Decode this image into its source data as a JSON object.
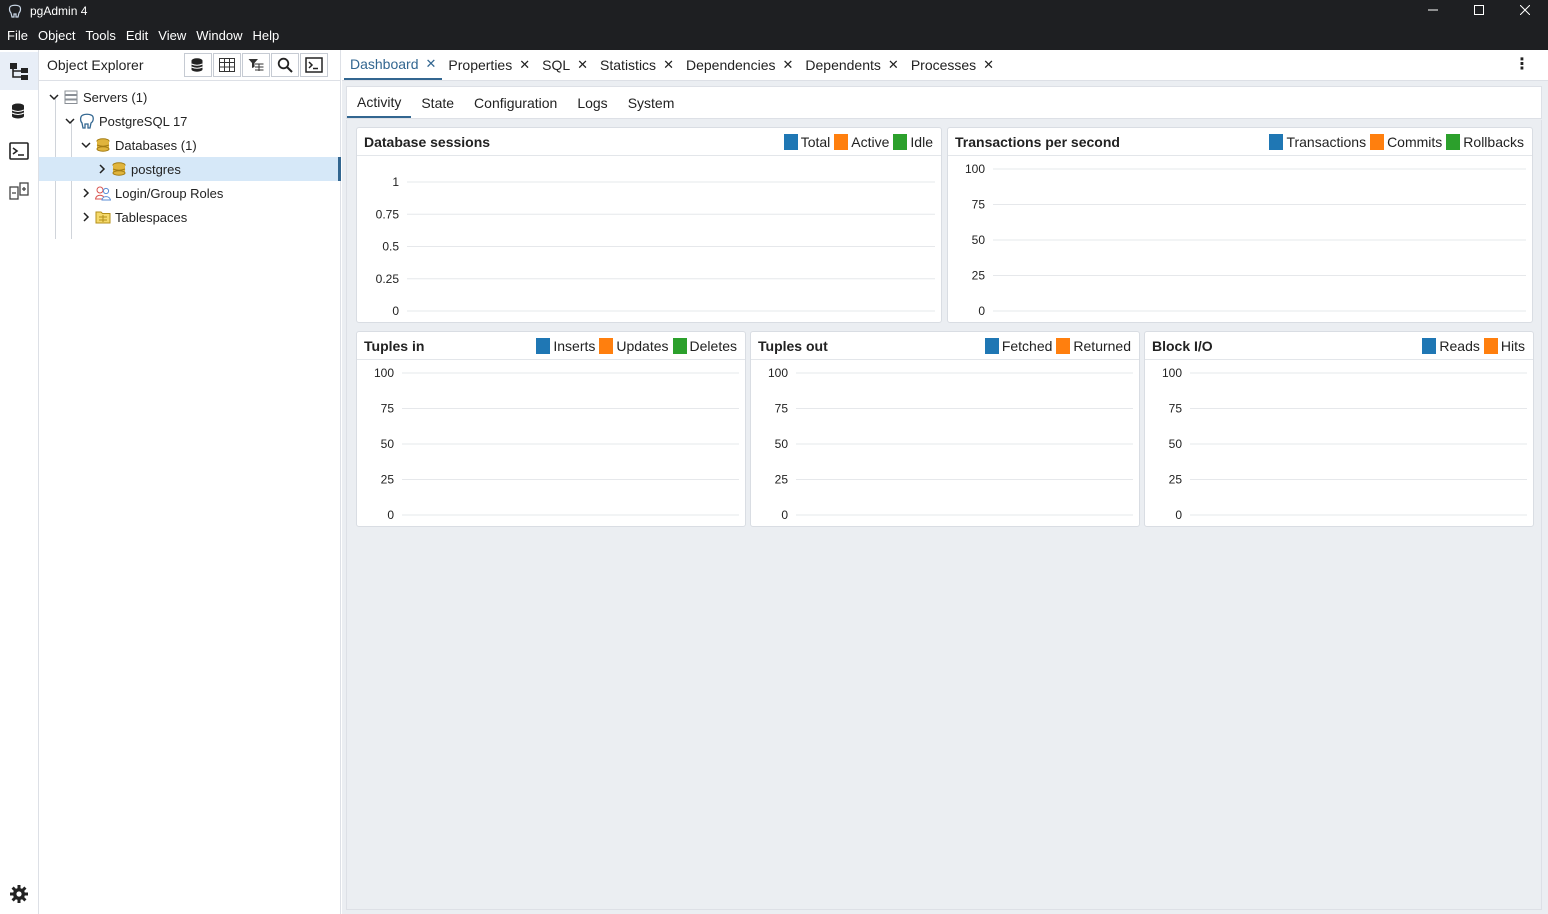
{
  "window": {
    "title": "pgAdmin 4"
  },
  "menu": [
    "File",
    "Object",
    "Tools",
    "Edit",
    "View",
    "Window",
    "Help"
  ],
  "explorer": {
    "title": "Object Explorer",
    "tree": [
      {
        "label": "Servers",
        "count": "(1)",
        "icon": "servers-icon",
        "level": 0,
        "expanded": true
      },
      {
        "label": "PostgreSQL 17",
        "count": "",
        "icon": "postgresql-elephant-icon",
        "level": 1,
        "expanded": true
      },
      {
        "label": "Databases",
        "count": "(1)",
        "icon": "databases-icon",
        "level": 2,
        "expanded": true
      },
      {
        "label": "postgres",
        "count": "",
        "icon": "database-icon",
        "level": 3,
        "expanded": false,
        "selected": true
      },
      {
        "label": "Login/Group Roles",
        "count": "",
        "icon": "roles-icon",
        "level": 2,
        "expanded": false
      },
      {
        "label": "Tablespaces",
        "count": "",
        "icon": "tablespaces-icon",
        "level": 2,
        "expanded": false
      }
    ]
  },
  "tabs": [
    {
      "label": "Dashboard",
      "active": true
    },
    {
      "label": "Properties"
    },
    {
      "label": "SQL"
    },
    {
      "label": "Statistics"
    },
    {
      "label": "Dependencies"
    },
    {
      "label": "Dependents"
    },
    {
      "label": "Processes"
    }
  ],
  "subtabs": [
    {
      "label": "Activity",
      "active": true
    },
    {
      "label": "State"
    },
    {
      "label": "Configuration"
    },
    {
      "label": "Logs"
    },
    {
      "label": "System"
    }
  ],
  "colors": {
    "blue": "#1f77b4",
    "orange": "#ff7f0e",
    "green": "#2ca02c",
    "accent": "#326690"
  },
  "chart_data": [
    {
      "type": "line",
      "title": "Database sessions",
      "series": [
        {
          "name": "Total",
          "color": "#1f77b4",
          "values": []
        },
        {
          "name": "Active",
          "color": "#ff7f0e",
          "values": []
        },
        {
          "name": "Idle",
          "color": "#2ca02c",
          "values": []
        }
      ],
      "yticks": [
        "0",
        "0.25",
        "0.5",
        "0.75",
        "1"
      ],
      "ylim": [
        0,
        1
      ],
      "grid": true,
      "legend": "top-right"
    },
    {
      "type": "line",
      "title": "Transactions per second",
      "series": [
        {
          "name": "Transactions",
          "color": "#1f77b4",
          "values": []
        },
        {
          "name": "Commits",
          "color": "#ff7f0e",
          "values": []
        },
        {
          "name": "Rollbacks",
          "color": "#2ca02c",
          "values": []
        }
      ],
      "yticks": [
        "0",
        "25",
        "50",
        "75",
        "100"
      ],
      "ylim": [
        0,
        100
      ],
      "grid": true,
      "legend": "top-right"
    },
    {
      "type": "line",
      "title": "Tuples in",
      "series": [
        {
          "name": "Inserts",
          "color": "#1f77b4",
          "values": []
        },
        {
          "name": "Updates",
          "color": "#ff7f0e",
          "values": []
        },
        {
          "name": "Deletes",
          "color": "#2ca02c",
          "values": []
        }
      ],
      "yticks": [
        "0",
        "25",
        "50",
        "75",
        "100"
      ],
      "ylim": [
        0,
        100
      ],
      "grid": true,
      "legend": "top-right"
    },
    {
      "type": "line",
      "title": "Tuples out",
      "series": [
        {
          "name": "Fetched",
          "color": "#1f77b4",
          "values": []
        },
        {
          "name": "Returned",
          "color": "#ff7f0e",
          "values": []
        }
      ],
      "yticks": [
        "0",
        "25",
        "50",
        "75",
        "100"
      ],
      "ylim": [
        0,
        100
      ],
      "grid": true,
      "legend": "top-right"
    },
    {
      "type": "line",
      "title": "Block I/O",
      "series": [
        {
          "name": "Reads",
          "color": "#1f77b4",
          "values": []
        },
        {
          "name": "Hits",
          "color": "#ff7f0e",
          "values": []
        }
      ],
      "yticks": [
        "0",
        "25",
        "50",
        "75",
        "100"
      ],
      "ylim": [
        0,
        100
      ],
      "grid": true,
      "legend": "top-right"
    }
  ]
}
